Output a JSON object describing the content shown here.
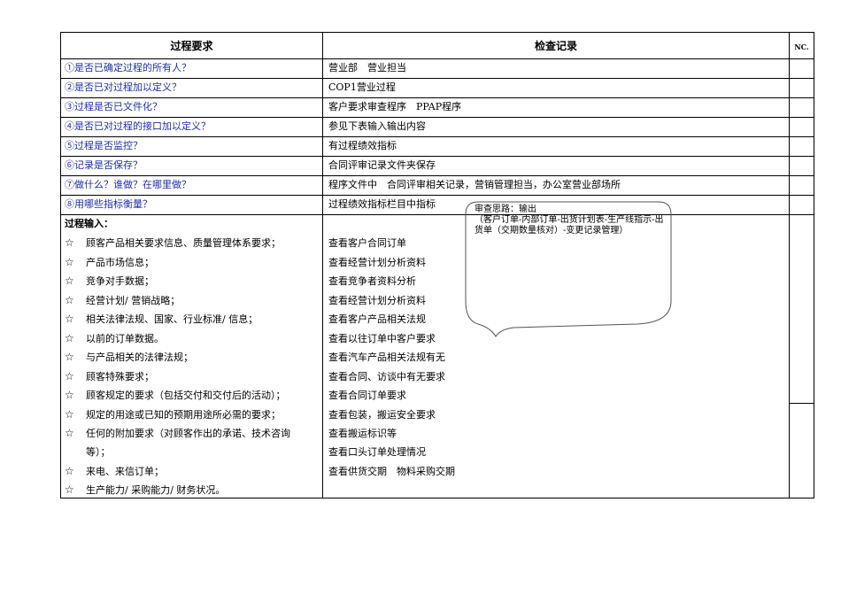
{
  "header": {
    "col1": "过程要求",
    "col2": "检查记录",
    "col3": "NC."
  },
  "rows": [
    {
      "q": "①是否已确定过程的所有人？",
      "a": "营业部　营业担当"
    },
    {
      "q": "②是否已对过程加以定义？",
      "a": "COP1营业过程"
    },
    {
      "q": "③过程是否已文件化？",
      "a": "客户要求审查程序　PPAP程序"
    },
    {
      "q": "④是否已对过程的接口加以定义？",
      "a": "参见下表输入输出内容"
    },
    {
      "q": "⑤过程是否监控？",
      "a": "有过程绩效指标"
    },
    {
      "q": "⑥记录是否保存？",
      "a": "合同评审记录文件夹保存"
    },
    {
      "q": "⑦做什么？谁做？在哪里做？",
      "a": "程序文件中　合同评审相关记录，营销管理担当，办公室营业部场所"
    },
    {
      "q": "⑧用哪些指标衡量？",
      "a": "过程绩效指标栏目中指标"
    }
  ],
  "inputs": {
    "title": "过程输入：",
    "star": "☆",
    "items": [
      "顾客产品相关要求信息、质量管理体系要求；",
      "产品市场信息；",
      "竞争对手数据；",
      "经营计划/ 营销战略；",
      "相关法律法规、国家、行业标准/ 信息；",
      "以前的订单数据。",
      "与产品相关的法律法规；",
      "顾客特殊要求；",
      "顾客规定的要求（包括交付和交付后的活动）；",
      "规定的用途或已知的预期用途所必需的要求；",
      "任何的附加要求（对顾客作出的承诺、技术咨询",
      "来电、来信订单；",
      "生产能力/ 采购能力/ 财务状况。"
    ],
    "wrap": "等）；",
    "checks": [
      "查看客户合同订单",
      "查看经营计划分析资料",
      "查看竞争者资料分析",
      "查看经营计划分析资料",
      "查看客户产品相关法规",
      "查看以往订单中客户要求",
      "查看汽车产品相关法规有无",
      "查看合同、访谈中有无要求",
      "查看合同订单要求",
      "查看包装，搬运安全要求",
      "查看搬运标识等",
      "查看口头订单处理情况",
      "查看供货交期　物料采购交期"
    ]
  },
  "bubble": {
    "line1": "审查思路：输出",
    "line2": "（客户订单-内部订单-出货计划表-生产线指示-出货单（交期数量核对）-变更记录管理）"
  }
}
